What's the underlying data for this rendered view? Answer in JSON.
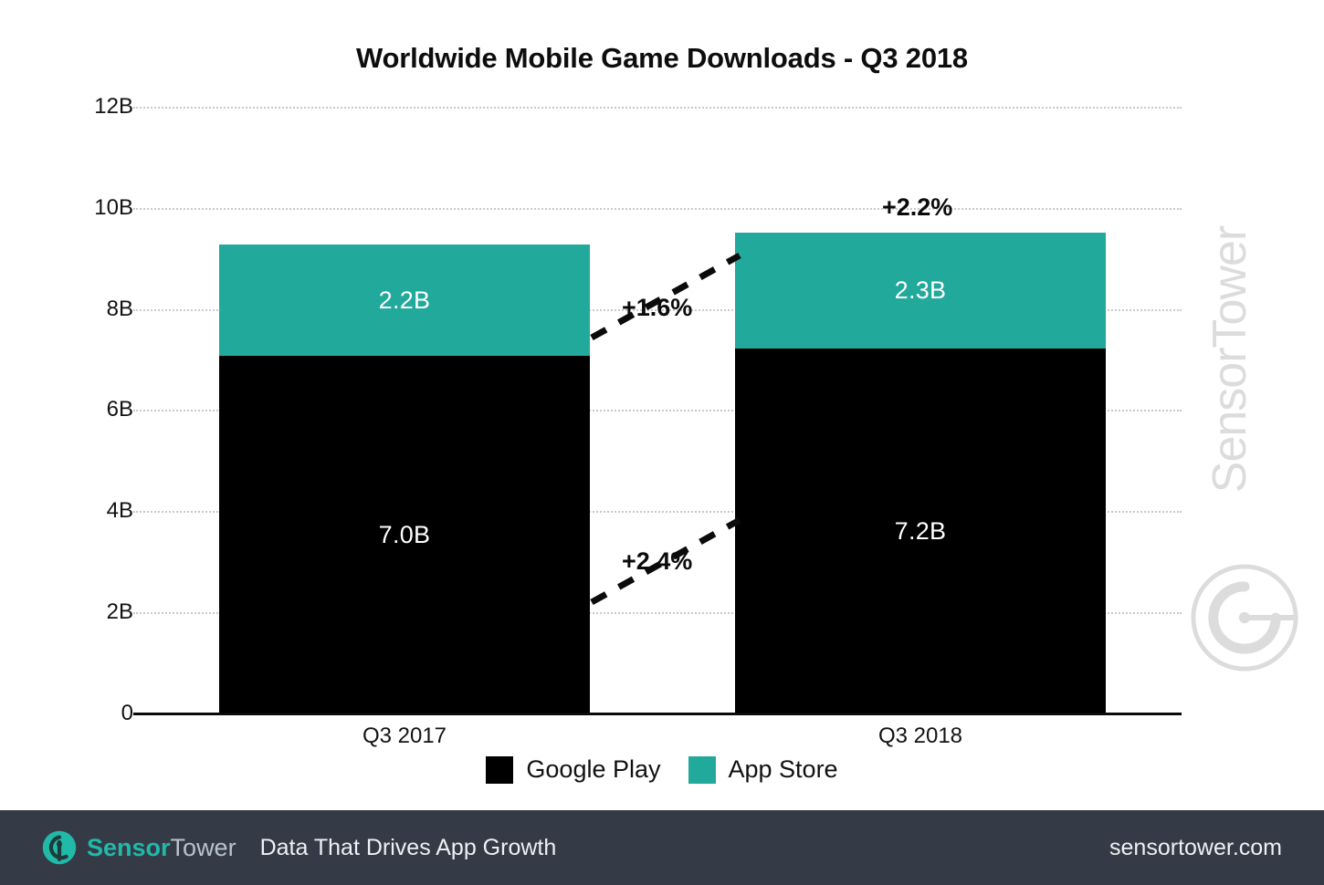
{
  "chart_data": {
    "type": "bar",
    "subtype": "stacked",
    "title": "Worldwide Mobile Game Downloads - Q3 2018",
    "xlabel": "",
    "ylabel": "",
    "ylim": [
      0,
      12
    ],
    "yunit": "B",
    "ytick_labels": [
      "0",
      "2B",
      "4B",
      "6B",
      "8B",
      "10B",
      "12B"
    ],
    "ytick_values": [
      0,
      2,
      4,
      6,
      8,
      10,
      12
    ],
    "grid": true,
    "legend_position": "bottom",
    "categories": [
      "Q3 2017",
      "Q3 2018"
    ],
    "series": [
      {
        "name": "Google Play",
        "color": "#000000",
        "values": [
          7.0,
          7.2
        ],
        "value_labels": [
          "7.0B",
          "7.2B"
        ]
      },
      {
        "name": "App Store",
        "color": "#21a99b",
        "values": [
          2.2,
          2.3
        ],
        "value_labels": [
          "2.2B",
          "2.3B"
        ]
      }
    ],
    "totals": [
      9.2,
      9.5
    ],
    "annotations": [
      {
        "id": "total-growth",
        "label": "+2.2%",
        "describes": "total"
      },
      {
        "id": "appstore-growth",
        "label": "+1.6%",
        "describes": "App Store"
      },
      {
        "id": "googleplay-growth",
        "label": "+2.4%",
        "describes": "Google Play"
      }
    ]
  },
  "watermark": {
    "text": "SensorTower",
    "color": "#dcdcdc"
  },
  "footer": {
    "brand_first": "Sensor",
    "brand_second": "Tower",
    "tagline": "Data That Drives App Growth",
    "url": "sensortower.com",
    "background": "#343b47",
    "accent": "#21b9a8"
  }
}
